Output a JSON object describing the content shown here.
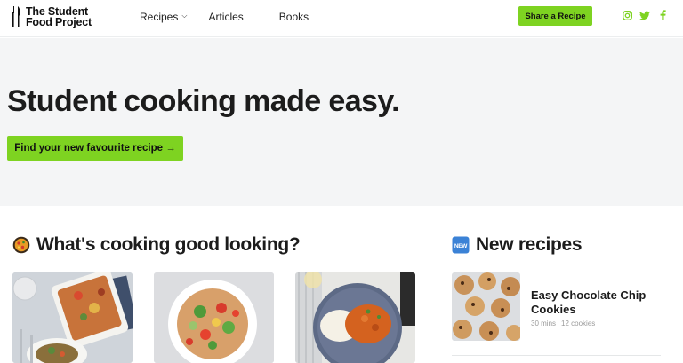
{
  "brand": {
    "name_line1": "The Student",
    "name_line2": "Food Project"
  },
  "nav": {
    "recipes": "Recipes",
    "articles": "Articles",
    "books": "Books"
  },
  "header": {
    "share_label": "Share a Recipe"
  },
  "socials": [
    "instagram-icon",
    "twitter-icon",
    "facebook-icon"
  ],
  "colors": {
    "accent": "#7ed321",
    "hero_bg": "#f4f5f6",
    "text": "#1c1c1c"
  },
  "hero": {
    "title": "Student cooking made easy.",
    "cta": "Find your new favourite recipe →"
  },
  "sections": {
    "cooking": {
      "title": "What's cooking good looking?",
      "emoji": "paella-pan-icon"
    },
    "new": {
      "title": "New recipes",
      "emoji": "new-badge-icon",
      "badge_text": "NEW"
    }
  },
  "cards": [
    {
      "image": "baked-pasta-dish-photo"
    },
    {
      "image": "salad-bowl-photo"
    },
    {
      "image": "curry-with-rice-photo"
    }
  ],
  "new_recipes": [
    {
      "name": "Easy Chocolate Chip Cookies",
      "time": "30 mins",
      "servings": "12 cookies",
      "image": "cookies-photo"
    }
  ]
}
